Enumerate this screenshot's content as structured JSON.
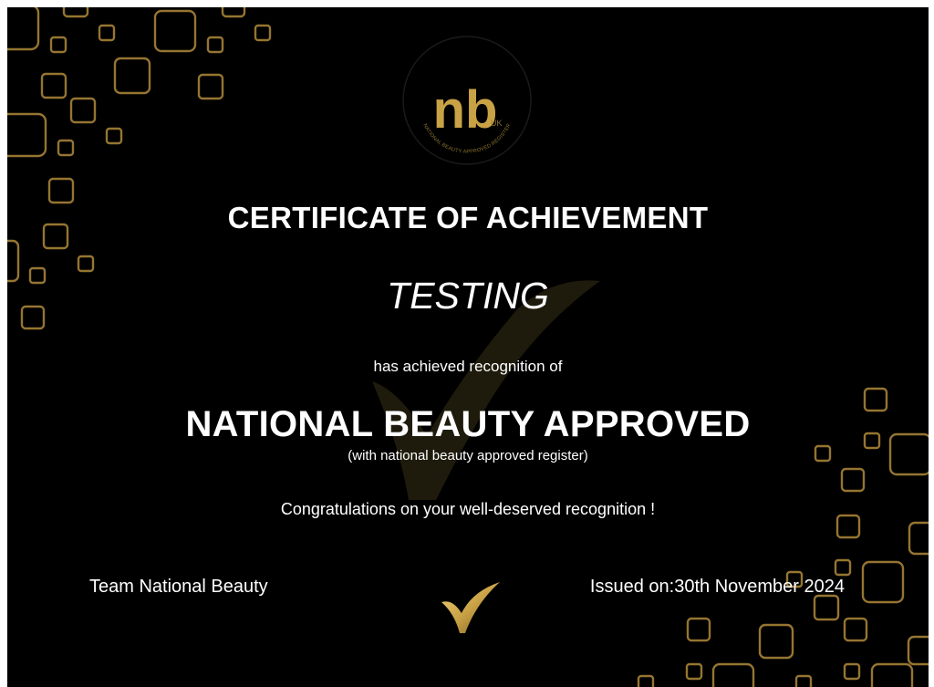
{
  "certificate": {
    "title": "CERTIFICATE OF ACHIEVEMENT",
    "recipient": "TESTING",
    "achieved_text": "has achieved recognition of",
    "award": "NATIONAL BEAUTY APPROVED",
    "award_sub": "(with national beauty approved register)",
    "congratulations": "Congratulations on your well-deserved recognition !",
    "team": "Team National Beauty",
    "issued": "Issued on:30th November 2024"
  },
  "logo": {
    "monogram": "nb",
    "suffix": "UK",
    "ring_text": "NATIONAL BEAUTY APPROVED REGISTER"
  },
  "icons": {
    "seal": "gold-check-icon",
    "watermark": "check-watermark-icon",
    "decoration": "rounded-squares-pattern"
  },
  "colors": {
    "background": "#000000",
    "gold": "#c9a246",
    "text": "#ffffff"
  }
}
